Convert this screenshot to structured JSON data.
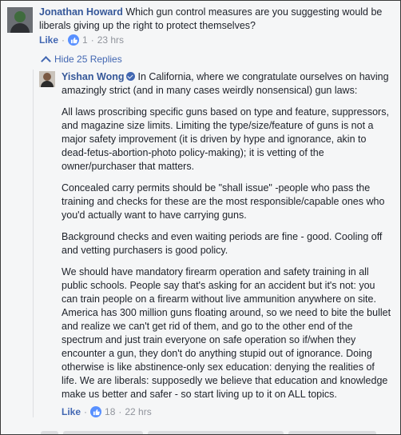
{
  "comment": {
    "author": "Jonathan Howard",
    "text": "Which gun control measures are you suggesting would be liberals giving up the right to protect themselves?",
    "like_label": "Like",
    "separator": "·",
    "like_count": "1",
    "time": "23 hrs"
  },
  "replies_toggle": {
    "label": "Hide 25 Replies"
  },
  "reply": {
    "author": "Yishan Wong",
    "intro": "In California, where we congratulate ourselves on having amazingly strict (and in many cases weirdly nonsensical) gun laws:",
    "paragraphs": [
      "All laws proscribing specific guns based on type and feature, suppressors, and magazine size limits. Limiting the type/size/feature of guns is not a major safety improvement (it is driven by hype and ignorance, akin to dead-fetus-abortion-photo policy-making); it is vetting of the owner/purchaser that matters.",
      "Concealed carry permits should be \"shall issue\" -people who pass the training and checks for these are the most responsible/capable ones who you'd actually want to have carrying guns.",
      "Background checks and even waiting periods are fine - good. Cooling off and vetting purchasers is good policy.",
      "We should have mandatory firearm operation and safety training in all public schools. People say that's asking for an accident but it's not: you can train people on a firearm without live ammunition anywhere on site. America has 300 million guns floating around, so we need to bite the bullet and realize we can't get rid of them, and go to the other end of the spectrum and just train everyone on safe operation so if/when they encounter a gun, they don't do anything stupid out of ignorance. Doing otherwise is like abstinence-only sex education: denying the realities of life. We are liberals: supposedly we believe that education and knowledge make us better and safer - so start living up to it on ALL topics."
    ],
    "like_label": "Like",
    "separator": "·",
    "like_count": "18",
    "time": "22 hrs"
  },
  "colors": {
    "link": "#365899",
    "accent": "#4267b2",
    "meta": "#90949c",
    "like_badge": "#5890ff"
  }
}
